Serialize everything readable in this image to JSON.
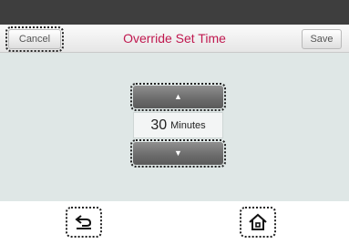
{
  "header": {
    "cancel_label": "Cancel",
    "title": "Override Set Time",
    "save_label": "Save"
  },
  "stepper": {
    "up_glyph": "▲",
    "value": "30",
    "unit": "Minutes",
    "down_glyph": "▼"
  },
  "nav": {
    "back_icon": "back-arrow-icon",
    "home_icon": "home-icon"
  },
  "colors": {
    "title": "#c0184f",
    "content_bg": "#dfe7e6",
    "status_bar": "#3e3e3e"
  }
}
